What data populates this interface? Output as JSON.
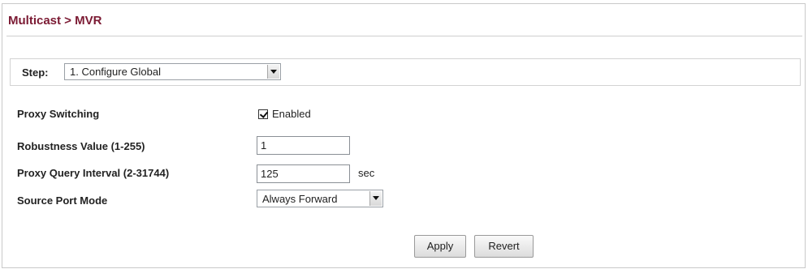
{
  "header": {
    "title": "Multicast > MVR"
  },
  "step": {
    "label": "Step:",
    "selected": "1. Configure Global"
  },
  "form": {
    "proxy_switching": {
      "label": "Proxy Switching",
      "checked": true,
      "option_label": "Enabled"
    },
    "robustness": {
      "label": "Robustness Value (1-255)",
      "value": "1"
    },
    "query_interval": {
      "label": "Proxy Query Interval (2-31744)",
      "value": "125",
      "unit": "sec"
    },
    "source_port_mode": {
      "label": "Source Port Mode",
      "selected": "Always Forward"
    }
  },
  "actions": {
    "apply_label": "Apply",
    "revert_label": "Revert"
  },
  "colors": {
    "title": "#7b1a33",
    "border": "#c9c9c9"
  }
}
